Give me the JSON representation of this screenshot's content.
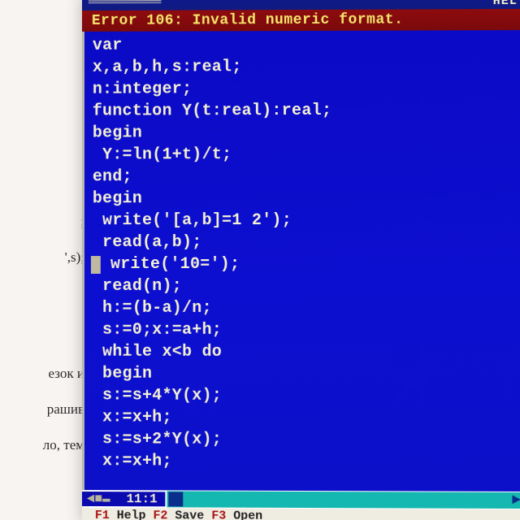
{
  "doc_fragments": [
    ";",
    "',s);",
    "езок и",
    "рашив",
    "ло, тем"
  ],
  "top": {
    "dashes": "══════════",
    "help": "HEL"
  },
  "error": "Error 106: Invalid numeric format.",
  "code_lines": [
    "var",
    "x,a,b,h,s:real;",
    "n:integer;",
    "function Y(t:real):real;",
    "begin",
    " Y:=ln(1+t)/t;",
    "end;",
    "begin",
    " write('[a,b]=1 2');",
    " read(a,b);",
    " write('10=');",
    " read(n);",
    " h:=(b-a)/n;",
    " s:=0;x:=a+h;",
    " while x<b do",
    " begin",
    " s:=s+4*Y(x);",
    " x:=x+h;",
    " s:=s+2*Y(x);",
    " x:=x+h;"
  ],
  "status": {
    "arrows": "◄■▬",
    "position": "11:1",
    "right_arrow": "►"
  },
  "hints": {
    "f1k": "F1",
    "f1t": " Help  ",
    "f2k": "F2",
    "f2t": " Save  ",
    "f3k": "F3",
    "f3t": " Open"
  }
}
